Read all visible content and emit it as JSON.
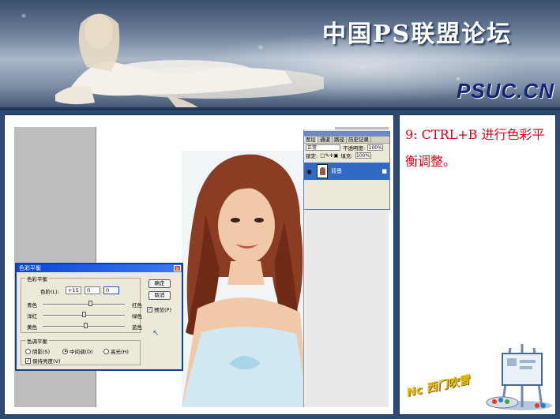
{
  "banner": {
    "title": "中国PS联盟论坛",
    "url": "PSUC.CN"
  },
  "layers_panel": {
    "tabs": [
      "图层",
      "通道",
      "路径",
      "历史记录"
    ],
    "blend_mode": "正常",
    "opacity_label": "不透明度:",
    "opacity_value": "100%",
    "lock_label": "锁定:",
    "fill_label": "填充:",
    "fill_value": "100%",
    "layer_name": "背景"
  },
  "color_balance_dialog": {
    "title": "色彩平衡",
    "group_balance": "色彩平衡",
    "levels_label": "色阶(L):",
    "levels": [
      "+15",
      "0",
      "0"
    ],
    "sliders": [
      {
        "left": "青色",
        "right": "红色",
        "value": 15
      },
      {
        "left": "洋红",
        "right": "绿色",
        "value": 0
      },
      {
        "left": "黄色",
        "right": "蓝色",
        "value": 0
      }
    ],
    "group_tone": "色调平衡",
    "tone_options": [
      "阴影(S)",
      "中间调(D)",
      "高光(H)"
    ],
    "tone_selected": "中间调(D)",
    "preserve_luminosity": "保持亮度(V)",
    "ok_button": "确定",
    "cancel_button": "取消",
    "preview_label": "预览(P)"
  },
  "instruction": {
    "text": "9: CTRL+B 进行色彩平衡调整。"
  },
  "footer_logo": "Nc 西门吹雪"
}
